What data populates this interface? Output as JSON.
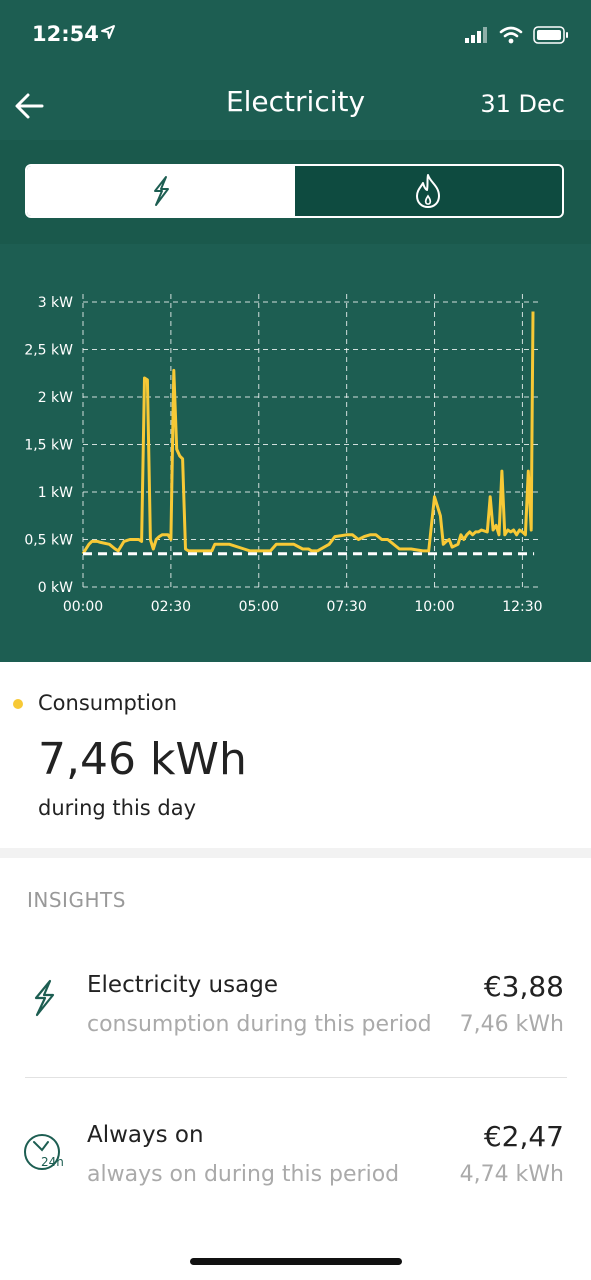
{
  "status_bar": {
    "time": "12:54"
  },
  "header": {
    "title": "Electricity",
    "date": "31 Dec"
  },
  "toggle": {
    "options": [
      "electricity-icon",
      "gas-flame-icon"
    ],
    "selected": "electricity"
  },
  "colors": {
    "header": "#1d5e52",
    "accent": "#f7c936",
    "toggle_dark": "#0e4b40"
  },
  "chart_data": {
    "type": "line",
    "yunit": "kW",
    "ylim": [
      0,
      3
    ],
    "xlim": [
      0,
      780
    ],
    "yticks": [
      "0 kW",
      "0,5 kW",
      "1 kW",
      "1,5 kW",
      "2 kW",
      "2,5 kW",
      "3 kW"
    ],
    "xticks": [
      "00:00",
      "02:30",
      "05:00",
      "07:30",
      "10:00",
      "12:30"
    ],
    "grid": true,
    "series": [
      {
        "name": "Consumption",
        "color": "#f7c936",
        "x": [
          0,
          5,
          10,
          15,
          25,
          30,
          45,
          55,
          60,
          70,
          80,
          95,
          100,
          105,
          110,
          115,
          120,
          125,
          130,
          135,
          140,
          145,
          150,
          155,
          160,
          165,
          170,
          175,
          180,
          190,
          200,
          220,
          225,
          240,
          250,
          275,
          285,
          300,
          320,
          330,
          340,
          345,
          360,
          375,
          385,
          390,
          400,
          420,
          430,
          450,
          460,
          470,
          480,
          490,
          500,
          510,
          520,
          540,
          560,
          580,
          590,
          600,
          610,
          615,
          620,
          625,
          630,
          640,
          645,
          650,
          655,
          660,
          665,
          670,
          675,
          680,
          690,
          695,
          700,
          705,
          710,
          715,
          720,
          725,
          730,
          735,
          740,
          745,
          750,
          755,
          760,
          765,
          768
        ],
        "y": [
          0.35,
          0.4,
          0.45,
          0.48,
          0.48,
          0.47,
          0.45,
          0.4,
          0.38,
          0.48,
          0.5,
          0.5,
          0.48,
          2.2,
          2.18,
          0.5,
          0.4,
          0.5,
          0.53,
          0.55,
          0.55,
          0.55,
          0.5,
          2.28,
          1.45,
          1.38,
          1.35,
          0.4,
          0.38,
          0.38,
          0.38,
          0.38,
          0.45,
          0.45,
          0.45,
          0.4,
          0.38,
          0.38,
          0.38,
          0.45,
          0.45,
          0.45,
          0.45,
          0.4,
          0.4,
          0.38,
          0.38,
          0.45,
          0.53,
          0.55,
          0.55,
          0.5,
          0.53,
          0.55,
          0.55,
          0.5,
          0.5,
          0.4,
          0.4,
          0.38,
          0.38,
          0.95,
          0.75,
          0.45,
          0.48,
          0.5,
          0.42,
          0.45,
          0.55,
          0.5,
          0.55,
          0.58,
          0.55,
          0.58,
          0.58,
          0.6,
          0.58,
          0.95,
          0.6,
          0.65,
          0.55,
          1.22,
          0.55,
          0.6,
          0.58,
          0.6,
          0.55,
          0.6,
          0.58,
          0.55,
          1.22,
          0.6,
          2.9
        ]
      },
      {
        "name": "Always on",
        "color": "#ffffff",
        "dashed": true,
        "x": [
          0,
          770
        ],
        "y": [
          0.35,
          0.35
        ]
      }
    ]
  },
  "summary": {
    "legend_label": "Consumption",
    "value": "7,46 kWh",
    "subtitle": "during this day"
  },
  "insights": {
    "title": "INSIGHTS",
    "items": [
      {
        "icon": "lightning-icon",
        "name": "Electricity usage",
        "amount": "€3,88",
        "desc": "consumption during this period",
        "kwh": "7,46 kWh"
      },
      {
        "icon": "always-on-24h-icon",
        "name": "Always on",
        "amount": "€2,47",
        "desc": "always on during this period",
        "kwh": "4,74 kWh"
      }
    ]
  }
}
